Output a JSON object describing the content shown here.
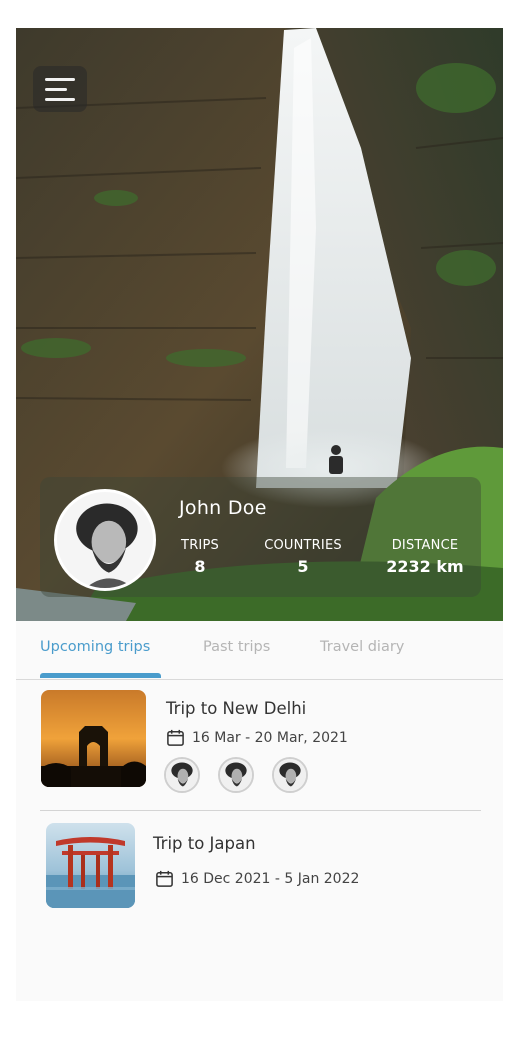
{
  "profile": {
    "name": "John Doe",
    "stats": [
      {
        "label": "TRIPS",
        "value": "8"
      },
      {
        "label": "COUNTRIES",
        "value": "5"
      },
      {
        "label": "DISTANCE",
        "value": "2232 km"
      }
    ]
  },
  "icons": {
    "menu": "hamburger-menu-icon",
    "calendar": "calendar-icon"
  },
  "tabs": [
    {
      "label": "Upcoming trips",
      "active": true
    },
    {
      "label": "Past trips",
      "active": false
    },
    {
      "label": "Travel diary",
      "active": false
    }
  ],
  "trips": [
    {
      "title": "Trip to New Delhi",
      "dates": "16 Mar - 20 Mar, 2021",
      "companions_count": 3
    },
    {
      "title": "Trip to Japan",
      "dates": "16 Dec 2021 - 5 Jan 2022",
      "companions_count": 0
    }
  ],
  "colors": {
    "accent": "#4a9ccc",
    "inactive_tab": "#b5b5b5"
  }
}
